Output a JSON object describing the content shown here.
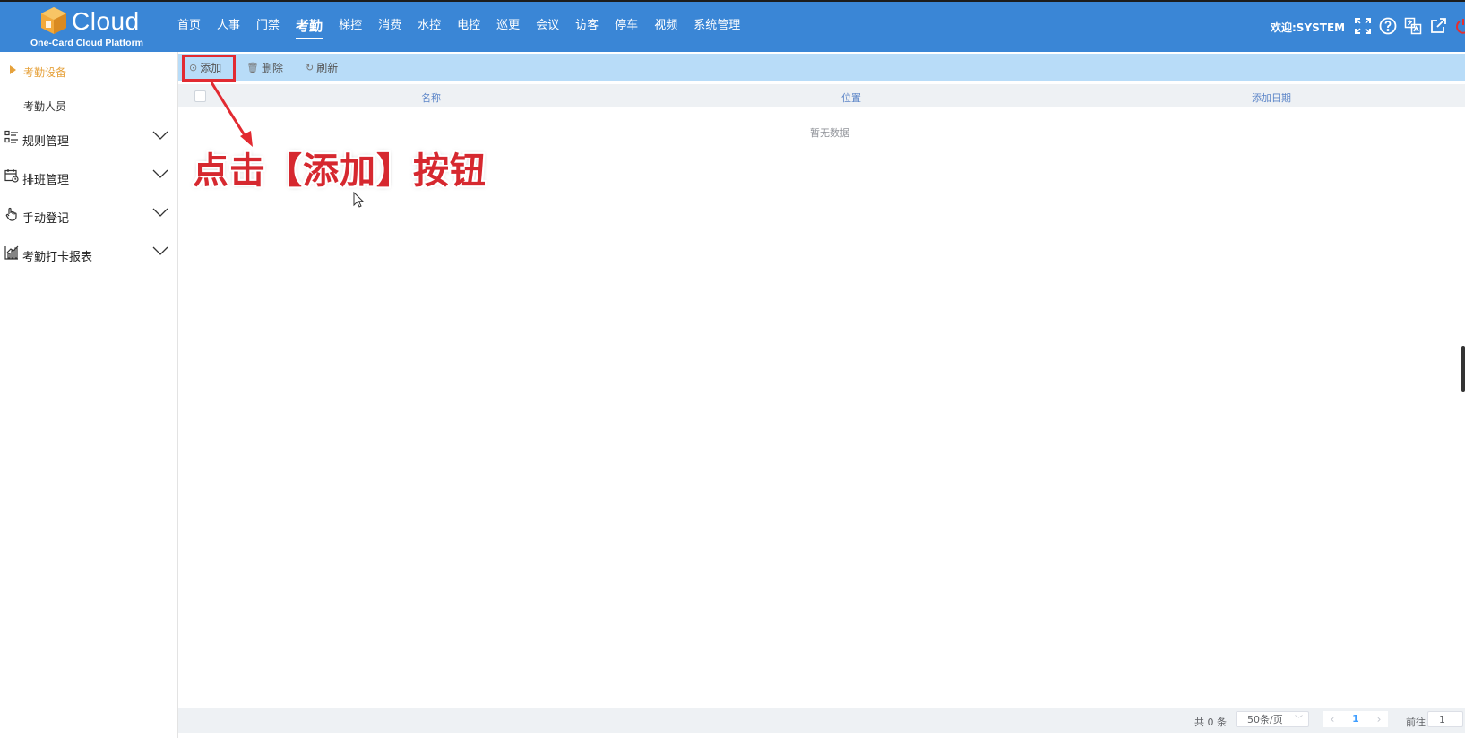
{
  "app": {
    "logo_text": "Cloud",
    "logo_sub": "One-Card Cloud Platform",
    "brand_color": "#3a86d6"
  },
  "nav": {
    "items": [
      "首页",
      "人事",
      "门禁",
      "考勤",
      "梯控",
      "消费",
      "水控",
      "电控",
      "巡更",
      "会议",
      "访客",
      "停车",
      "视频",
      "系统管理"
    ],
    "active": "考勤"
  },
  "header": {
    "welcome": "欢迎:SYSTEM",
    "icons": [
      "fullscreen-icon",
      "help-icon",
      "translate-icon",
      "external-link-icon",
      "power-icon"
    ]
  },
  "sidebar": {
    "sub_items": [
      {
        "label": "考勤设备",
        "active": true
      },
      {
        "label": "考勤人员",
        "active": false
      }
    ],
    "groups": [
      {
        "label": "规则管理",
        "icon": "list-icon"
      },
      {
        "label": "排班管理",
        "icon": "calendar-icon"
      },
      {
        "label": "手动登记",
        "icon": "hand-icon"
      },
      {
        "label": "考勤打卡报表",
        "icon": "chart-icon"
      }
    ],
    "accent_color": "#e6a23c"
  },
  "toolbar": {
    "add_label": "添加",
    "delete_label": "删除",
    "refresh_label": "刷新"
  },
  "table": {
    "columns": [
      "名称",
      "位置",
      "添加日期"
    ],
    "empty_text": "暂无数据"
  },
  "annotation": {
    "text": "点击【添加】按钮",
    "color": "#d6282f"
  },
  "pagination": {
    "total": "共 0 条",
    "page_size": "50条/页",
    "current_page": "1",
    "goto_label": "前往",
    "goto_value": "1"
  }
}
